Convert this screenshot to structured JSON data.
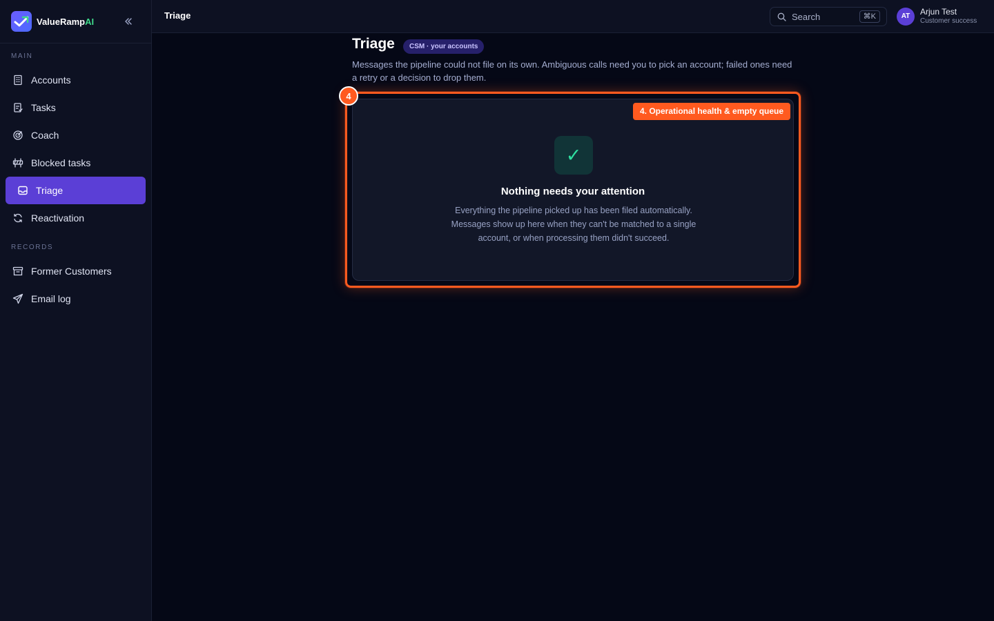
{
  "brand": {
    "name_main": "ValueRamp",
    "name_accent": "AI",
    "logo_icon": "check-logo-icon",
    "collapse_icon": "double-chevron-left-icon"
  },
  "sidebar": {
    "sections": [
      {
        "label": "MAIN",
        "items": [
          {
            "label": "Accounts",
            "icon": "building-icon"
          },
          {
            "label": "Tasks",
            "icon": "clipboard-icon"
          },
          {
            "label": "Coach",
            "icon": "target-icon"
          },
          {
            "label": "Blocked tasks",
            "icon": "barrier-icon"
          },
          {
            "label": "Triage",
            "icon": "inbox-icon",
            "active": true
          },
          {
            "label": "Reactivation",
            "icon": "refresh-icon"
          }
        ]
      },
      {
        "label": "RECORDS",
        "items": [
          {
            "label": "Former Customers",
            "icon": "archive-icon"
          },
          {
            "label": "Email log",
            "icon": "send-icon"
          }
        ]
      }
    ]
  },
  "topbar": {
    "title": "Triage",
    "search_label": "Search",
    "search_shortcut": "⌘K",
    "user": {
      "initials": "AT",
      "name": "Arjun Test",
      "role": "Customer success"
    }
  },
  "main": {
    "title": "Triage",
    "badge": "CSM · your accounts",
    "description": "Messages the pipeline could not file on its own. Ambiguous calls need you to pick an account; failed ones need a retry or a decision to drop them."
  },
  "annotation": {
    "step_number": "4",
    "step_label": "4. Operational health & empty queue",
    "color": "#ff5a1f"
  },
  "empty_state": {
    "icon": "check-icon",
    "glyph": "✓",
    "title": "Nothing needs your attention",
    "description": "Everything the pipeline picked up has been filed automatically. Messages show up here when they can't be matched to a single account, or when processing them didn't succeed."
  },
  "colors": {
    "accent": "#5b3fd6",
    "brand_accent_text": "#3fd98a",
    "success": "#2fe0a0",
    "background": "#050816",
    "panel": "#0d1122"
  }
}
